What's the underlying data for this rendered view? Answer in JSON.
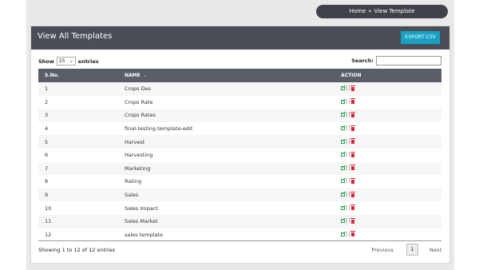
{
  "breadcrumb": {
    "home": "Home",
    "separator": "»",
    "current": "View Template"
  },
  "panel": {
    "title": "View All Templates",
    "export_label": "EXPORT CSV"
  },
  "controls": {
    "show_label": "Show",
    "page_size": "25",
    "entries_label": "entries",
    "search_label": "Search:",
    "search_value": ""
  },
  "table": {
    "headers": {
      "sno": "S.No.",
      "name": "NAME",
      "action": "ACTION"
    },
    "rows": [
      {
        "sno": "1",
        "name": "Crops Des"
      },
      {
        "sno": "2",
        "name": "Crops Rate"
      },
      {
        "sno": "3",
        "name": "Crops Rates"
      },
      {
        "sno": "4",
        "name": "final-testing-template-edit"
      },
      {
        "sno": "5",
        "name": "Harvest"
      },
      {
        "sno": "6",
        "name": "Harvesting"
      },
      {
        "sno": "7",
        "name": "Marketing"
      },
      {
        "sno": "8",
        "name": "Rating"
      },
      {
        "sno": "9",
        "name": "Sales"
      },
      {
        "sno": "10",
        "name": "Sales Impact"
      },
      {
        "sno": "11",
        "name": "Sales Market"
      },
      {
        "sno": "12",
        "name": "sales template"
      }
    ],
    "action_separator": "| |"
  },
  "footer": {
    "info": "Showing 1 to 12 of 12 entries",
    "previous": "Previous",
    "current_page": "1",
    "next": "Next"
  },
  "colors": {
    "header_bg": "#4a4f57",
    "table_head_bg": "#5a5f67",
    "export_btn": "#17a2c4",
    "edit_icon": "#2aa64a",
    "delete_icon": "#d9263b"
  }
}
